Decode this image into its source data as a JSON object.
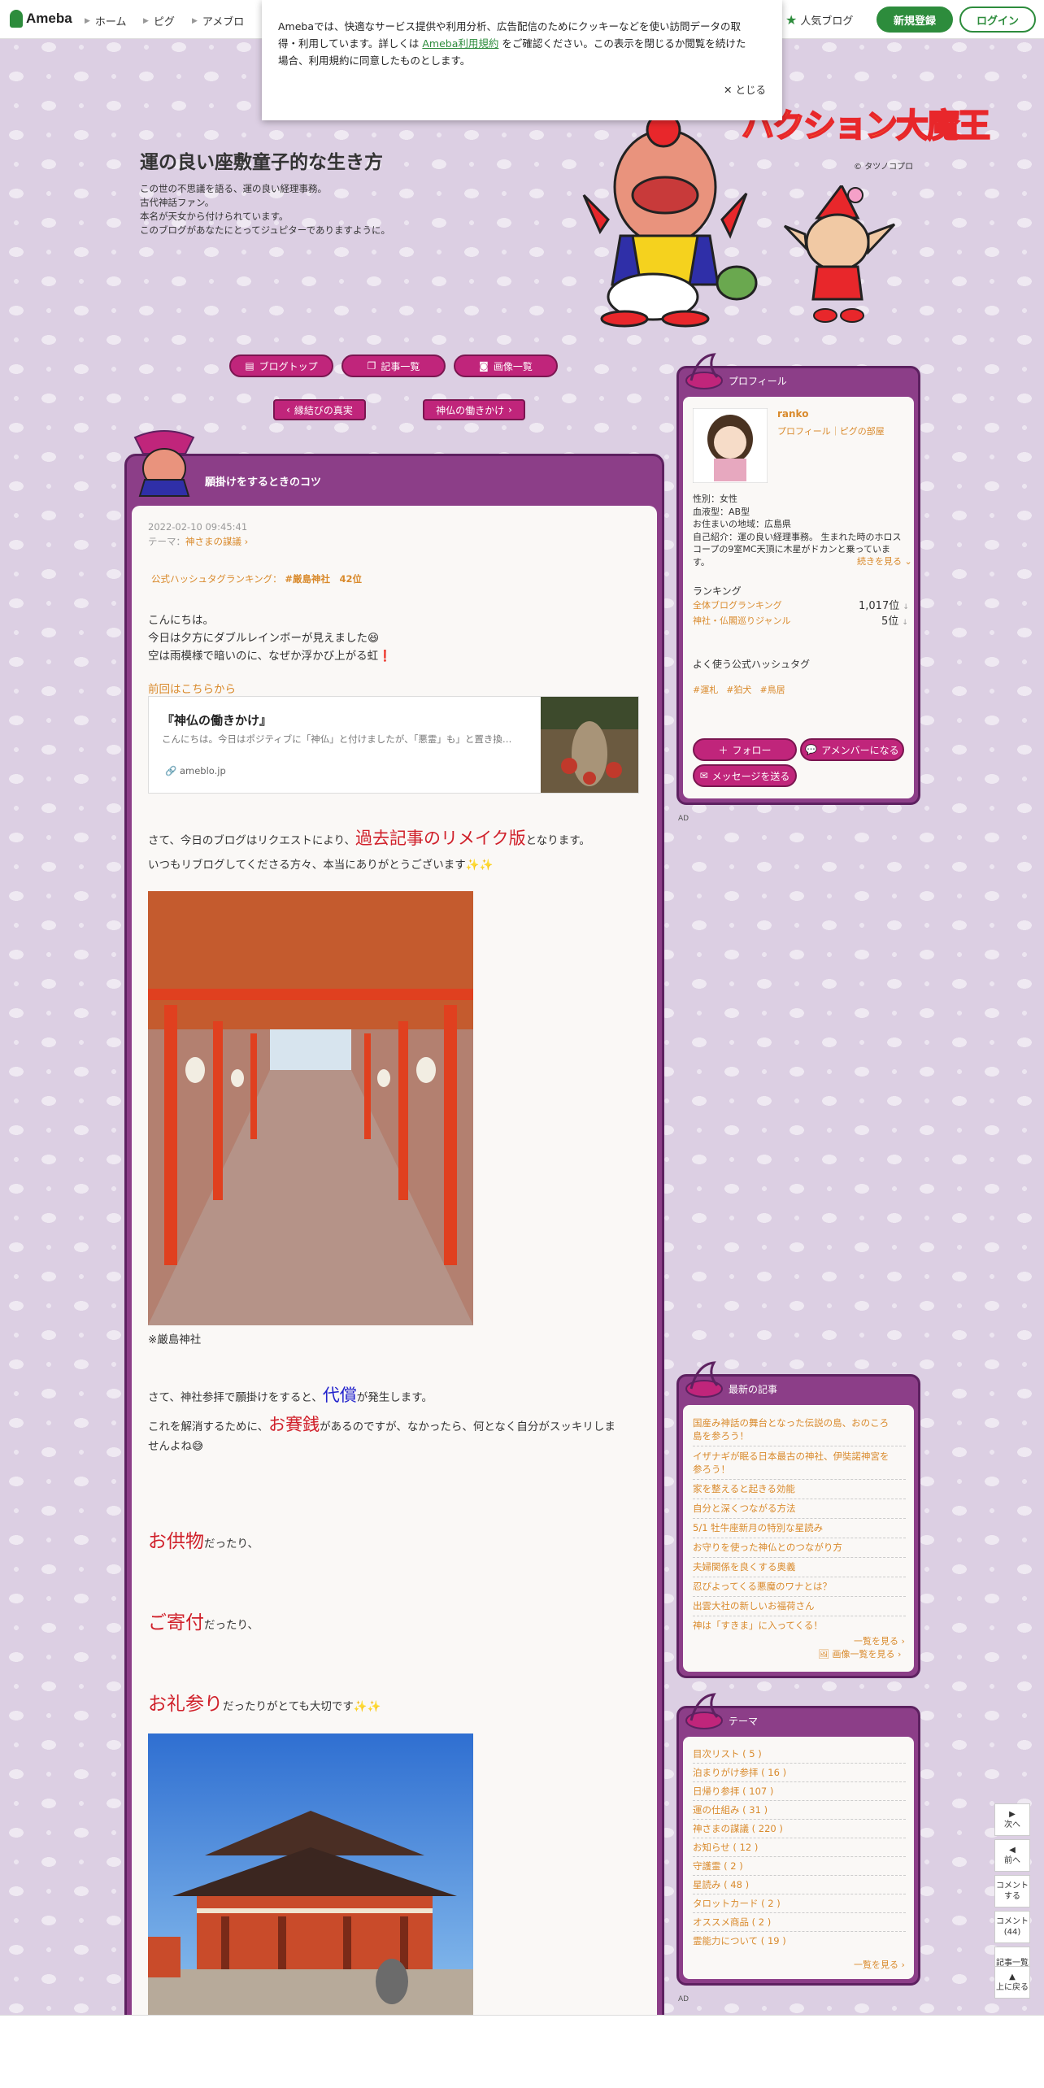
{
  "header": {
    "logo": "Ameba",
    "nav": [
      "ホーム",
      "ピグ",
      "アメブロ"
    ],
    "popular": "人気ブログ",
    "signup": "新規登録",
    "login": "ログイン"
  },
  "cookie": {
    "text1": "Amebaでは、快適なサービス提供や利用分析、広告配信のためにクッキーなどを使い訪問データの取",
    "text2a": "得・利用しています。詳しくは ",
    "link": "Ameba利用規約",
    "text2b": " をご確認ください。この表示を閉じるか閲覧を続けた",
    "text3": "場合、利用規約に同意したものとします。",
    "close": "とじる"
  },
  "blog": {
    "title": "運の良い座敷童子的な生き方",
    "desc": [
      "この世の不思議を語る、運の良い経理事務。",
      "古代神話ファン。",
      "本名が天女から付けられています。",
      "このブログがあなたにとってジュピターでありますように。"
    ],
    "banner": "ハクション大魔王",
    "copyright": "タツノコプロ"
  },
  "nav": {
    "top": "ブログトップ",
    "list": "記事一覧",
    "images": "画像一覧",
    "prev": "縁結びの真実",
    "next": "神仏の働きかけ"
  },
  "article": {
    "title": "願掛けをするときのコツ",
    "date": "2022-02-10 09:45:41",
    "theme_label": "テーマ：",
    "theme": "神さまの謀議",
    "hashtag_label": "公式ハッシュタグランキング：",
    "hashtag": "#厳島神社　42位",
    "p1": "こんにちは。",
    "p2": "今日は夕方にダブルレインボーが見えました😆",
    "p3": "空は雨模様で暗いのに、なぜか浮かび上がる虹❗",
    "prev_link": "前回はこちらから",
    "card": {
      "title": "『神仏の働きかけ』",
      "desc": "こんにちは。今日はポジティブに「神仏」と付けましたが、「悪霊」も」と置き換…",
      "site": "ameblo.jp"
    },
    "p4a": "さて、今日のブログはリクエストにより、",
    "p4b": "過去記事のリメイク版",
    "p4c": "となります。",
    "p5": "いつもリブログしてくださる方々、本当にありがとうございます✨✨",
    "caption1": "※厳島神社",
    "p6a": "さて、神社参拝で願掛けをすると、",
    "p6b": "代償",
    "p6c": "が発生します。",
    "p7a": "これを解消するために、",
    "p7b": "お賽銭",
    "p7c": "があるのですが、なかったら、何となく自分がスッキリしま",
    "p7d": "せんよね😅",
    "p8a": "お供物",
    "p8b": "だったり、",
    "p9a": "ご寄付",
    "p9b": "だったり、",
    "p10a": "お礼参り",
    "p10b": "だったりがとても大切です✨✨"
  },
  "profile": {
    "head": "プロフィール",
    "name": "ranko",
    "links": "プロフィール｜ピグの部屋",
    "info": [
      "性別：女性",
      "血液型：AB型",
      "お住まいの地域：広島県",
      "自己紹介：運の良い経理事務。 生まれた時のホロス",
      "コープの9室MC天頂に木星がドカンと乗っていま",
      "す。"
    ],
    "more": "続きを見る",
    "ranking_head": "ランキング",
    "rank1_label": "全体ブログランキング",
    "rank1_value": "1,017位",
    "rank2_label": "神社・仏閣巡りジャンル",
    "rank2_value": "5位",
    "hashtag_head": "よく使う公式ハッシュタグ",
    "hashtags": [
      "#運札",
      "#狛犬",
      "#鳥居"
    ],
    "follow": "フォロー",
    "member": "アメンバーになる",
    "message": "メッセージを送る"
  },
  "ad": "AD",
  "recent": {
    "head": "最新の記事",
    "items": [
      "国産み神話の舞台となった伝説の島、おのころ",
      "島を参ろう！",
      "イザナギが眠る日本最古の神社、伊奘諾神宮を",
      "参ろう！",
      "家を整えると起きる効能",
      "自分と深くつながる方法",
      "5/1 牡牛座新月の特別な星読み",
      "お守りを使った神仏とのつながり方",
      "夫婦関係を良くする奥義",
      "忍びよってくる悪魔のワナとは？",
      "出雲大社の新しいお福荷さん",
      "神は「すきま」に入ってくる！"
    ],
    "more": "一覧を見る",
    "images": "画像一覧を見る"
  },
  "theme": {
    "head": "テーマ",
    "items": [
      "目次リスト ( 5 )",
      "泊まりがけ参拝 ( 16 )",
      "日帰り参拝 ( 107 )",
      "運の仕組み ( 31 )",
      "神さまの謀議 ( 220 )",
      "お知らせ ( 12 )",
      "守護霊 ( 2 )",
      "星読み ( 48 )",
      "タロットカード ( 2 )",
      "オススメ商品 ( 2 )",
      "霊能力について ( 19 )"
    ],
    "more": "一覧を見る"
  },
  "floatnav": {
    "next": "次へ",
    "prev": "前へ",
    "comment1": "コメント",
    "comment2": "する",
    "count1": "コメント",
    "count2": "(44)",
    "list": "記事一覧",
    "top": "上に戻る"
  },
  "colors": {
    "brand": "#2d8c3c",
    "frame": "#8c3e88",
    "accent": "#c0257b",
    "link": "#d98a2c",
    "red": "#d0202a",
    "blue": "#2222cc"
  }
}
